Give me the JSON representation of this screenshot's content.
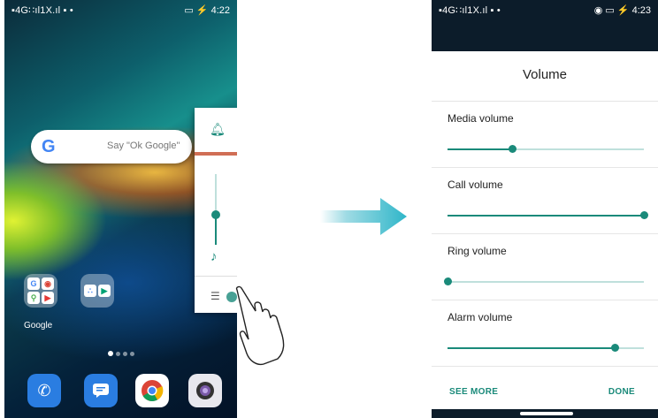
{
  "left_phone": {
    "status_left": "▪4G∷ıl1X.ıl ▪ •",
    "status_right": "▭ ⚡ 4:22",
    "search": {
      "logo": "G",
      "placeholder": "Say \"Ok Google\""
    },
    "volume_panel": {
      "level": 0.45
    },
    "folder_label": "Google",
    "page_dots": 4,
    "active_dot": 0,
    "dock": [
      {
        "name": "phone-icon",
        "color": "#2a7de1"
      },
      {
        "name": "messages-icon",
        "color": "#2a7de1"
      },
      {
        "name": "chrome-icon",
        "color": "#ffffff"
      },
      {
        "name": "camera-icon",
        "color": "#e8e8ee"
      }
    ]
  },
  "right_phone": {
    "status_left": "▪4G∷ıl1X.ıl ▪ •",
    "status_right": "◉ ▭ ⚡ 4:23",
    "dialog": {
      "title": "Volume",
      "rows": [
        {
          "label": "Media volume",
          "level": 0.33
        },
        {
          "label": "Call volume",
          "level": 1.0
        },
        {
          "label": "Ring volume",
          "level": 0.0
        },
        {
          "label": "Alarm volume",
          "level": 0.85
        }
      ],
      "see_more": "SEE MORE",
      "done": "DONE"
    }
  },
  "colors": {
    "accent": "#1a8a7a",
    "arrow": "#2fb6c9"
  }
}
